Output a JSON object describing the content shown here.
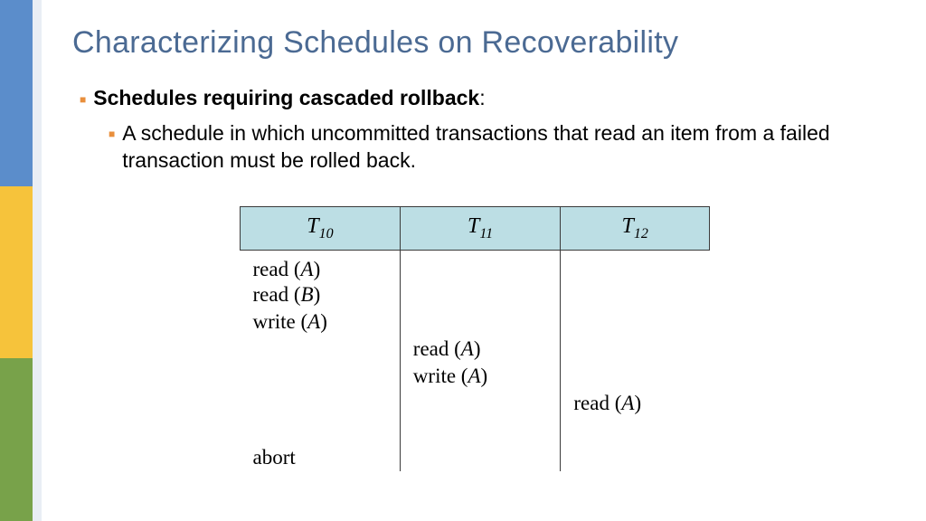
{
  "title": "Characterizing Schedules on Recoverability",
  "bullet1_bold": "Schedules requiring cascaded rollback",
  "colon": ":",
  "bullet2": "A schedule in which uncommitted transactions that read an item from a failed transaction must be rolled back.",
  "table": {
    "headers": [
      {
        "sym": "T",
        "sub": "10"
      },
      {
        "sym": "T",
        "sub": "11"
      },
      {
        "sym": "T",
        "sub": "12"
      }
    ],
    "rows": [
      {
        "c0": "read (A)",
        "c1": "",
        "c2": ""
      },
      {
        "c0": "read (B)",
        "c1": "",
        "c2": ""
      },
      {
        "c0": "write (A)",
        "c1": "",
        "c2": ""
      },
      {
        "c0": "",
        "c1": "read (A)",
        "c2": ""
      },
      {
        "c0": "",
        "c1": "write (A)",
        "c2": ""
      },
      {
        "c0": "",
        "c1": "",
        "c2": "read (A)"
      },
      {
        "c0": "",
        "c1": "",
        "c2": ""
      },
      {
        "c0": "abort",
        "c1": "",
        "c2": ""
      }
    ]
  }
}
